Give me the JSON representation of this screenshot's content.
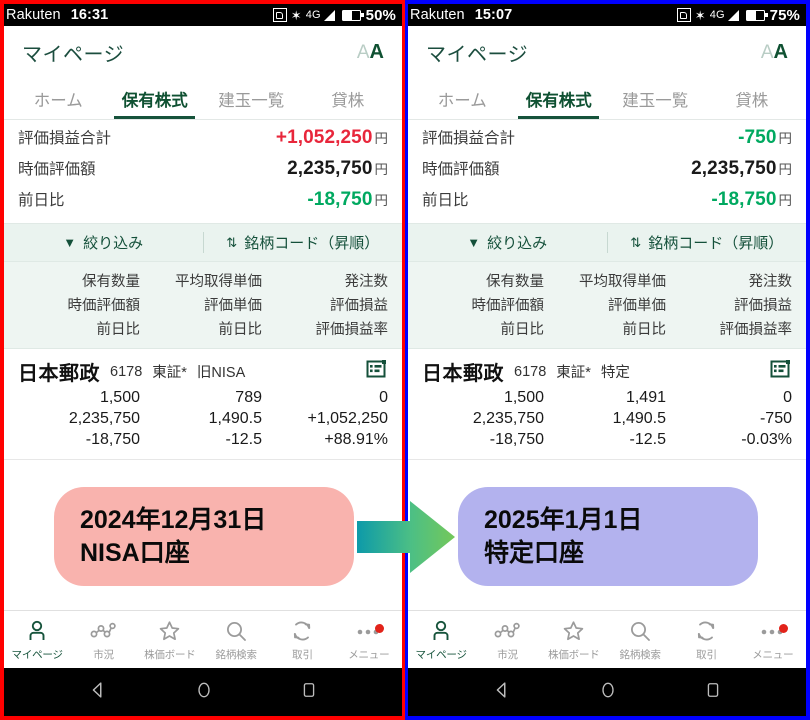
{
  "panels": [
    {
      "id": "left",
      "border_color": "#ff0000",
      "statusbar": {
        "carrier": "Rakuten",
        "time": "16:31",
        "network": "4G",
        "battery_pct": "50%"
      },
      "header": {
        "title": "マイページ",
        "fontsize_small": "A",
        "fontsize_big": "A"
      },
      "tabs": [
        {
          "label": "ホーム",
          "active": false
        },
        {
          "label": "保有株式",
          "active": true
        },
        {
          "label": "建玉一覧",
          "active": false
        },
        {
          "label": "貸株",
          "active": false
        }
      ],
      "summary": [
        {
          "label": "評価損益合計",
          "value": "+1,052,250",
          "unit": "円",
          "tone": "pos"
        },
        {
          "label": "時価評価額",
          "value": "2,235,750",
          "unit": "円",
          "tone": "neu"
        },
        {
          "label": "前日比",
          "value": "-18,750",
          "unit": "円",
          "tone": "neg"
        }
      ],
      "filterbar": {
        "filter_label": "絞り込み",
        "sort_label": "銘柄コード（昇順）"
      },
      "column_headers": {
        "col1": [
          "保有数量",
          "時価評価額",
          "前日比"
        ],
        "col2": [
          "平均取得単価",
          "評価単価",
          "前日比"
        ],
        "col3": [
          "発注数",
          "評価損益",
          "評価損益率"
        ]
      },
      "holding": {
        "name": "日本郵政",
        "code": "6178",
        "market": "東証*",
        "account": "旧NISA",
        "row1": {
          "qty": "1,500",
          "avg_price": "789",
          "orders": "0",
          "tones": [
            "neu",
            "neu",
            "neu"
          ]
        },
        "row2": {
          "market_value": "2,235,750",
          "eval_price": "1,490.5",
          "pl": "+1,052,250",
          "tones": [
            "neu",
            "neu",
            "pos"
          ]
        },
        "row3": {
          "prev_diff": "-18,750",
          "prev_diff_price": "-12.5",
          "pl_rate": "+88.91%",
          "tones": [
            "neg",
            "neg",
            "pos"
          ]
        }
      },
      "bottomnav": [
        {
          "label": "マイページ",
          "icon": "person-icon",
          "active": true,
          "badge": false
        },
        {
          "label": "市況",
          "icon": "market-graph-icon",
          "active": false,
          "badge": false
        },
        {
          "label": "株価ボード",
          "icon": "star-icon",
          "active": false,
          "badge": false
        },
        {
          "label": "銘柄検索",
          "icon": "search-icon",
          "active": false,
          "badge": false
        },
        {
          "label": "取引",
          "icon": "refresh-icon",
          "active": false,
          "badge": false
        },
        {
          "label": "メニュー",
          "icon": "ellipsis-icon",
          "active": false,
          "badge": true
        }
      ]
    },
    {
      "id": "right",
      "border_color": "#0000ff",
      "statusbar": {
        "carrier": "Rakuten",
        "time": "15:07",
        "network": "4G",
        "battery_pct": "75%"
      },
      "header": {
        "title": "マイページ",
        "fontsize_small": "A",
        "fontsize_big": "A"
      },
      "tabs": [
        {
          "label": "ホーム",
          "active": false
        },
        {
          "label": "保有株式",
          "active": true
        },
        {
          "label": "建玉一覧",
          "active": false
        },
        {
          "label": "貸株",
          "active": false
        }
      ],
      "summary": [
        {
          "label": "評価損益合計",
          "value": "-750",
          "unit": "円",
          "tone": "neg"
        },
        {
          "label": "時価評価額",
          "value": "2,235,750",
          "unit": "円",
          "tone": "neu"
        },
        {
          "label": "前日比",
          "value": "-18,750",
          "unit": "円",
          "tone": "neg"
        }
      ],
      "filterbar": {
        "filter_label": "絞り込み",
        "sort_label": "銘柄コード（昇順）"
      },
      "column_headers": {
        "col1": [
          "保有数量",
          "時価評価額",
          "前日比"
        ],
        "col2": [
          "平均取得単価",
          "評価単価",
          "前日比"
        ],
        "col3": [
          "発注数",
          "評価損益",
          "評価損益率"
        ]
      },
      "holding": {
        "name": "日本郵政",
        "code": "6178",
        "market": "東証*",
        "account": "特定",
        "row1": {
          "qty": "1,500",
          "avg_price": "1,491",
          "orders": "0",
          "tones": [
            "neu",
            "neu",
            "neu"
          ]
        },
        "row2": {
          "market_value": "2,235,750",
          "eval_price": "1,490.5",
          "pl": "-750",
          "tones": [
            "neu",
            "neu",
            "neg"
          ]
        },
        "row3": {
          "prev_diff": "-18,750",
          "prev_diff_price": "-12.5",
          "pl_rate": "-0.03%",
          "tones": [
            "neg",
            "neg",
            "neg"
          ]
        }
      },
      "bottomnav": [
        {
          "label": "マイページ",
          "icon": "person-icon",
          "active": true,
          "badge": false
        },
        {
          "label": "市況",
          "icon": "market-graph-icon",
          "active": false,
          "badge": false
        },
        {
          "label": "株価ボード",
          "icon": "star-icon",
          "active": false,
          "badge": false
        },
        {
          "label": "銘柄検索",
          "icon": "search-icon",
          "active": false,
          "badge": false
        },
        {
          "label": "取引",
          "icon": "refresh-icon",
          "active": false,
          "badge": false
        },
        {
          "label": "メニュー",
          "icon": "ellipsis-icon",
          "active": false,
          "badge": true
        }
      ]
    }
  ],
  "annotations": {
    "left_bubble": {
      "line1": "2024年12月31日",
      "line2": "NISA口座",
      "color": "#f9b3ae"
    },
    "right_bubble": {
      "line1": "2025年1月1日",
      "line2": "特定口座",
      "color": "#b3b2ee"
    },
    "arrow": {
      "color_start": "#109aa8",
      "color_end": "#6cc45c"
    }
  },
  "colors": {
    "positive": "#e8263b",
    "negative": "#00a960",
    "brand_green": "#16533b",
    "filterbar_bg": "#eaf3ef",
    "colhead_bg": "#eef5f2"
  }
}
